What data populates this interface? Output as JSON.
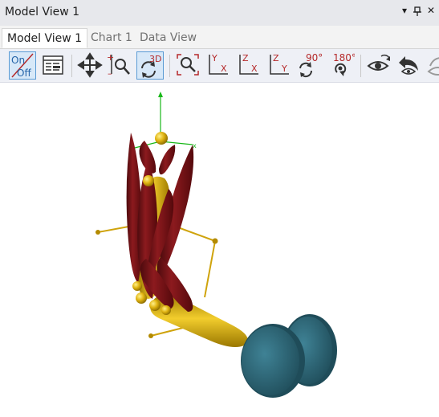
{
  "window": {
    "title": "Model View 1"
  },
  "tabs": [
    {
      "label": "Model View 1",
      "active": true
    },
    {
      "label": "Chart 1",
      "active": false
    },
    {
      "label": "Data View",
      "active": false
    }
  ],
  "toolbar": {
    "on_off_on": "On",
    "on_off_off": "Off",
    "view_3d_label": "3D",
    "axis_yx": [
      "Y",
      "X"
    ],
    "axis_zx": [
      "Z",
      "X"
    ],
    "axis_zy": [
      "Z",
      "Y"
    ],
    "rotate_90_label": "90°",
    "rotate_180_label": "180°"
  },
  "colors": {
    "accent": "#5b9bd5",
    "toolbar_red": "#b5292a",
    "muscle": "#7b1518",
    "bone": "#d7aa0b",
    "weight": "#2f6575"
  },
  "icons": [
    "window-menu-icon",
    "pin-icon",
    "close-icon",
    "move-icon",
    "zoom-region-icon",
    "rotate-3d-icon",
    "zoom-fit-icon",
    "rotate-90-icon",
    "rotate-180-icon",
    "view-eye-icon",
    "undo-view-icon",
    "redo-view-icon"
  ]
}
